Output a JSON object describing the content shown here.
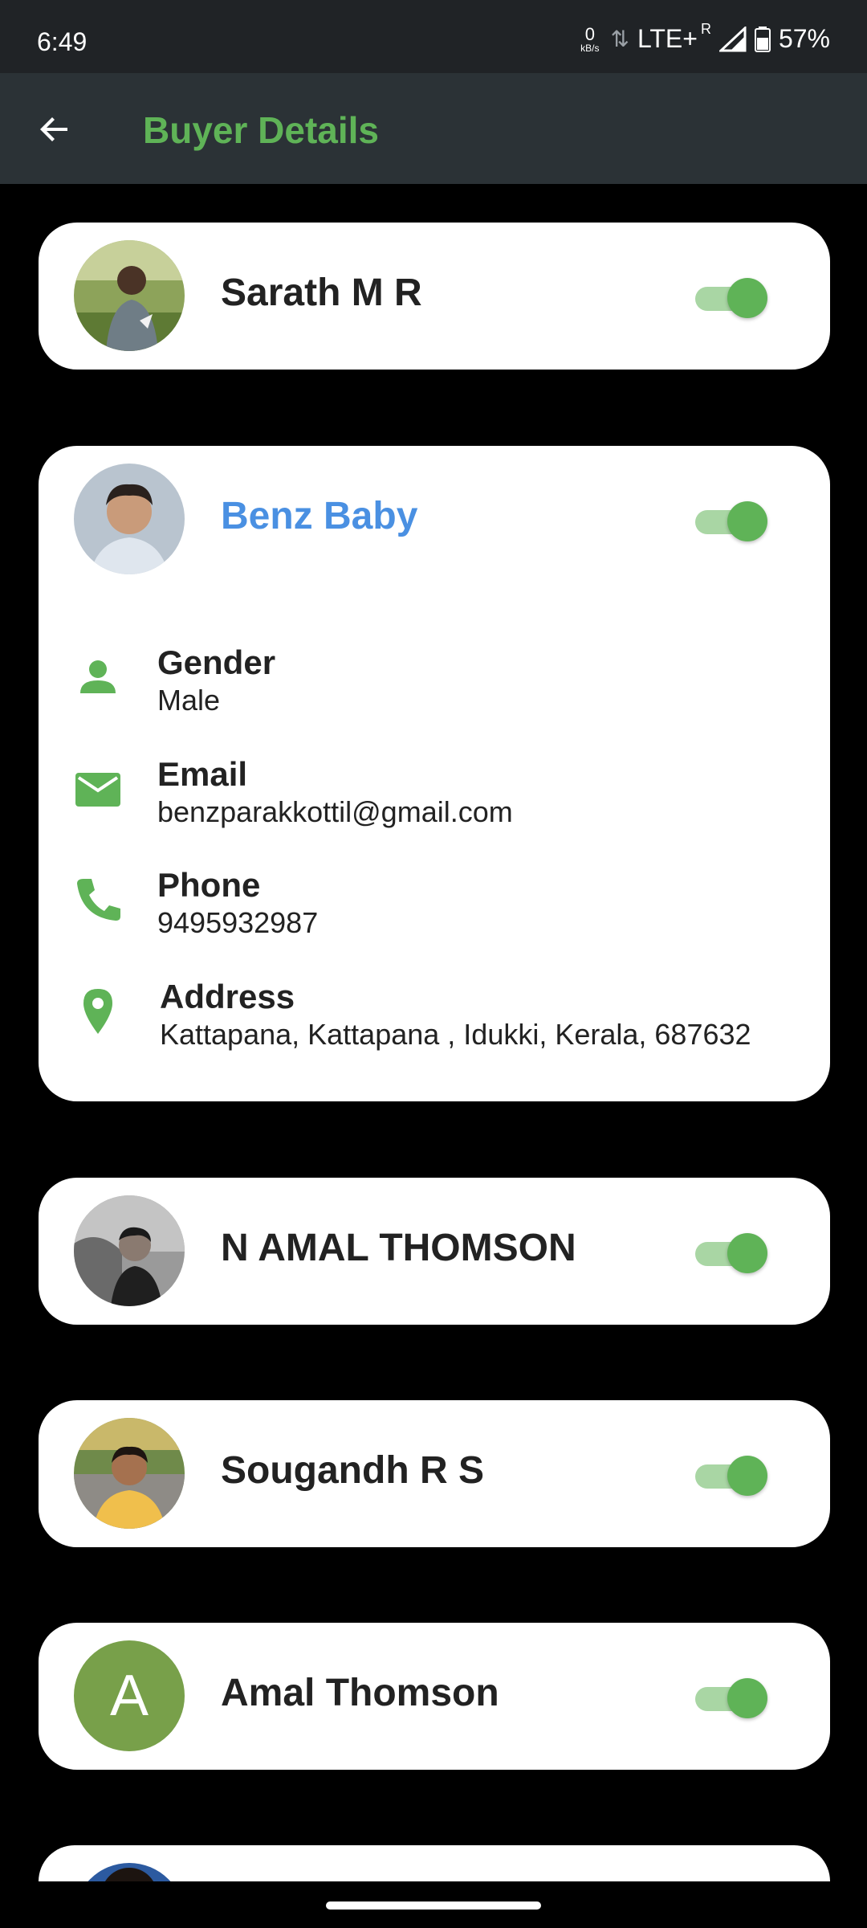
{
  "status": {
    "time": "6:49",
    "kbs_value": "0",
    "kbs_unit": "kB/s",
    "network": "LTE+",
    "roaming": "R",
    "battery": "57%"
  },
  "appbar": {
    "title": "Buyer Details"
  },
  "buyers": [
    {
      "name": "Sarath M R",
      "enabled": true
    },
    {
      "name": "Benz Baby",
      "enabled": true,
      "details": {
        "gender_label": "Gender",
        "gender": "Male",
        "email_label": "Email",
        "email": "benzparakkottil@gmail.com",
        "phone_label": "Phone",
        "phone": "9495932987",
        "address_label": "Address",
        "address": "Kattapana, Kattapana , Idukki, Kerala, 687632"
      }
    },
    {
      "name": "N AMAL THOMSON",
      "enabled": true
    },
    {
      "name": "Sougandh R S",
      "enabled": true
    },
    {
      "name": "Amal Thomson",
      "enabled": true,
      "initial": "A"
    }
  ],
  "colors": {
    "accent_green": "#5fb357",
    "active_name": "#4a90e2",
    "appbar": "#2b3236"
  }
}
